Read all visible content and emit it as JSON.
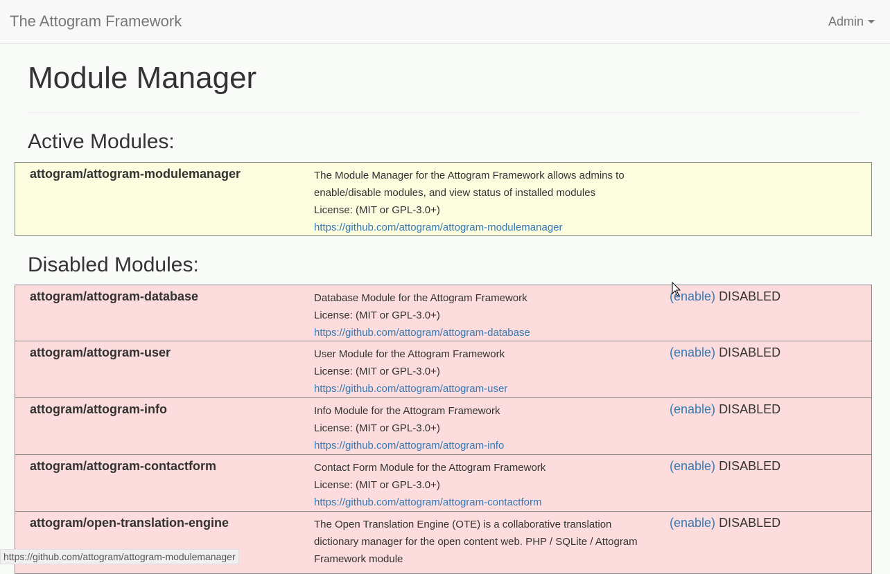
{
  "navbar": {
    "brand": "The Attogram Framework",
    "admin_label": "Admin"
  },
  "page": {
    "title": "Module Manager"
  },
  "active_section": {
    "heading": "Active Modules:",
    "modules": [
      {
        "name": "attogram/attogram-modulemanager",
        "description_lines": [
          "The Module Manager for the Attogram Framework allows admins to",
          "enable/disable modules, and view status of installed modules"
        ],
        "license": "License: (MIT or GPL-3.0+)",
        "url": "https://github.com/attogram/attogram-modulemanager"
      }
    ]
  },
  "disabled_section": {
    "heading": "Disabled Modules:",
    "enable_label": "(enable)",
    "status_label": "DISABLED",
    "modules": [
      {
        "name": "attogram/attogram-database",
        "description": "Database Module for the Attogram Framework",
        "license": "License: (MIT or GPL-3.0+)",
        "url": "https://github.com/attogram/attogram-database"
      },
      {
        "name": "attogram/attogram-user",
        "description": "User Module for the Attogram Framework",
        "license": "License: (MIT or GPL-3.0+)",
        "url": "https://github.com/attogram/attogram-user"
      },
      {
        "name": "attogram/attogram-info",
        "description": "Info Module for the Attogram Framework",
        "license": "License: (MIT or GPL-3.0+)",
        "url": "https://github.com/attogram/attogram-info"
      },
      {
        "name": "attogram/attogram-contactform",
        "description": "Contact Form Module for the Attogram Framework",
        "license": "License: (MIT or GPL-3.0+)",
        "url": "https://github.com/attogram/attogram-contactform"
      },
      {
        "name": "attogram/open-translation-engine",
        "description_lines": [
          "The Open Translation Engine (OTE) is a collaborative translation",
          "dictionary manager for the open content web. PHP / SQLite / Attogram",
          "Framework module"
        ]
      }
    ]
  },
  "statusbar": {
    "text": "https://github.com/attogram/attogram-modulemanager"
  }
}
